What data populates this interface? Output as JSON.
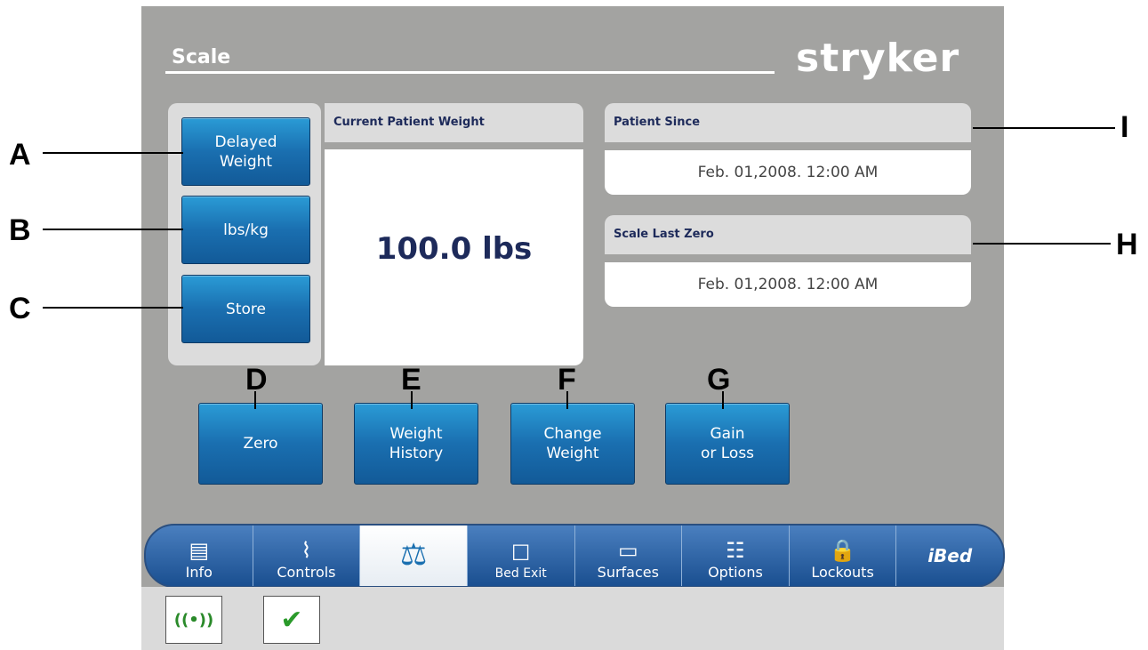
{
  "screen": {
    "title": "Scale",
    "brand": "stryker"
  },
  "weight": {
    "header": "Current Patient Weight",
    "value": "100.0 lbs"
  },
  "side_buttons": [
    {
      "label": "Delayed\nWeight",
      "callout": "A"
    },
    {
      "label": "lbs/kg",
      "callout": "B"
    },
    {
      "label": "Store",
      "callout": "C"
    }
  ],
  "bottom_buttons": [
    {
      "label": "Zero",
      "callout": "D"
    },
    {
      "label": "Weight\nHistory",
      "callout": "E"
    },
    {
      "label": "Change\nWeight",
      "callout": "F"
    },
    {
      "label": "Gain\nor Loss",
      "callout": "G"
    }
  ],
  "patient_since": {
    "header": "Patient Since",
    "value": "Feb. 01,2008. 12:00 AM",
    "callout": "I"
  },
  "scale_last_zero": {
    "header": "Scale Last Zero",
    "value": "Feb. 01,2008. 12:00 AM",
    "callout": "H"
  },
  "nav_tabs": [
    {
      "label": "Info",
      "icon": "info-icon",
      "glyph": "▤"
    },
    {
      "label": "Controls",
      "icon": "patient-bed-icon",
      "glyph": "⌇"
    },
    {
      "label": "",
      "icon": "scale-icon",
      "glyph": "⚖"
    },
    {
      "label": "Bed Exit",
      "icon": "bed-exit-icon",
      "glyph": "☐"
    },
    {
      "label": "Surfaces",
      "icon": "surface-icon",
      "glyph": "▭"
    },
    {
      "label": "Options",
      "icon": "options-sliders-icon",
      "glyph": "☷"
    },
    {
      "label": "Lockouts",
      "icon": "lock-icon",
      "glyph": "🔒"
    },
    {
      "label": "iBed",
      "icon": "ibed-icon",
      "glyph": ""
    }
  ],
  "status_icons": [
    {
      "name": "wireless-icon",
      "glyph": "((•))"
    },
    {
      "name": "bed-check-icon",
      "glyph": "✔"
    }
  ],
  "colors": {
    "panel_bg": "#a3a3a1",
    "button_blue": "#1a6fb0",
    "text_navy": "#1d2a5a"
  }
}
